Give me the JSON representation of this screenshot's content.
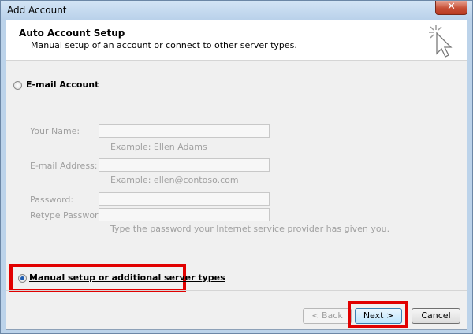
{
  "window": {
    "title": "Add Account",
    "close_glyph": "✕"
  },
  "header": {
    "title": "Auto Account Setup",
    "subtitle": "Manual setup of an account or connect to other server types.",
    "icon": "cursor-click-icon"
  },
  "email_option": {
    "label": "E-mail Account",
    "selected": false
  },
  "form": {
    "your_name_label": "Your Name:",
    "your_name_value": "",
    "your_name_hint": "Example: Ellen Adams",
    "email_label": "E-mail Address:",
    "email_value": "",
    "email_hint": "Example: ellen@contoso.com",
    "password_label": "Password:",
    "password_value": "",
    "retype_label": "Retype Password:",
    "retype_value": "",
    "password_hint": "Type the password your Internet service provider has given you."
  },
  "manual_option": {
    "label": "Manual setup or additional server types",
    "selected": true
  },
  "buttons": {
    "back": "< Back",
    "next": "Next >",
    "cancel": "Cancel"
  },
  "colors": {
    "highlight": "#e10000",
    "radio_dot": "#1e5cb0"
  }
}
